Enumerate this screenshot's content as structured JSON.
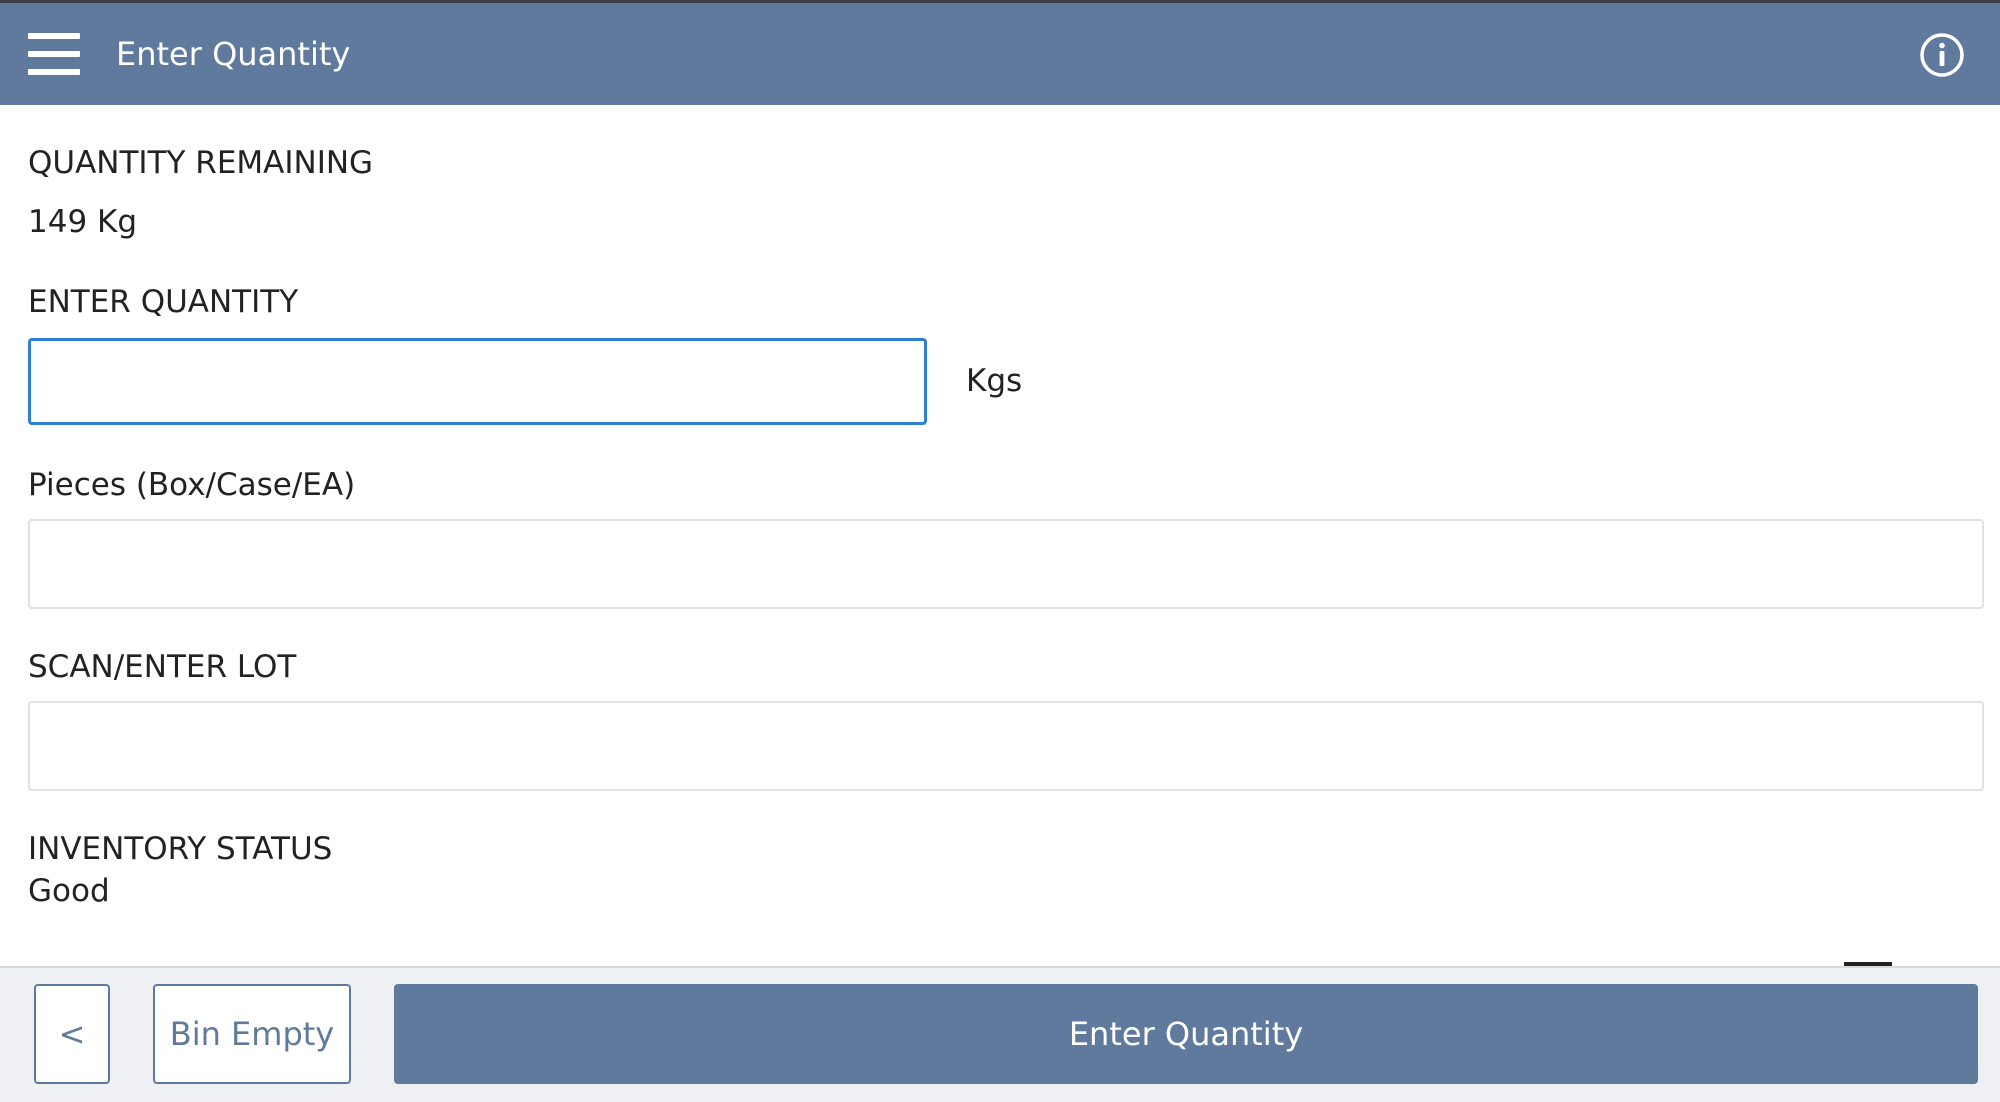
{
  "header": {
    "title": "Enter Quantity"
  },
  "quantity_remaining": {
    "label": "QUANTITY REMAINING",
    "value": "149 Kg"
  },
  "enter_quantity": {
    "label": "ENTER QUANTITY",
    "value": "",
    "placeholder": "",
    "unit": "Kgs"
  },
  "pieces": {
    "label": "Pieces (Box/Case/EA)",
    "value": "",
    "placeholder": ""
  },
  "lot": {
    "label": "SCAN/ENTER LOT",
    "value": "",
    "placeholder": ""
  },
  "inventory_status": {
    "label": "INVENTORY STATUS",
    "value": "Good"
  },
  "footer": {
    "back_label": "<",
    "bin_empty_label": "Bin Empty",
    "primary_label": "Enter Quantity"
  },
  "icons": {
    "menu": "hamburger-menu-icon",
    "info": "info-circle-icon"
  },
  "colors": {
    "header_bg": "#5f7a9c",
    "focus_border": "#2f7fd3",
    "footer_bg": "#eef0f3"
  }
}
